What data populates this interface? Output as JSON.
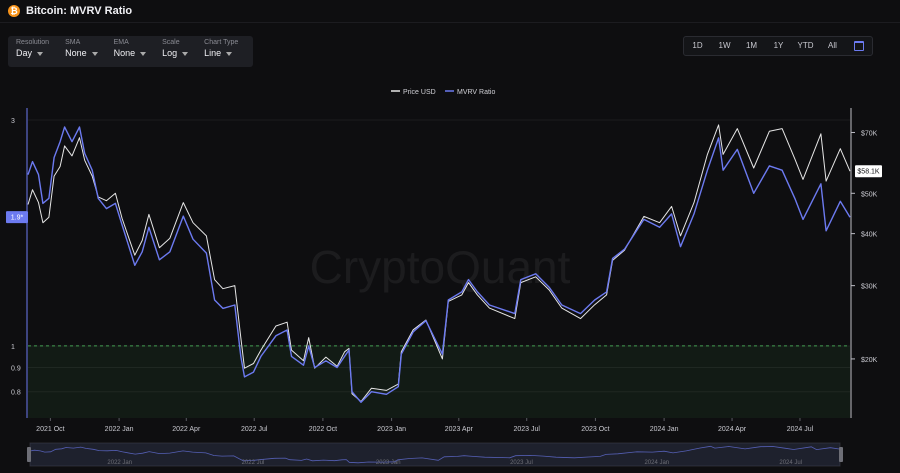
{
  "header": {
    "coin_glyph": "₿",
    "title": "Bitcoin: MVRV Ratio"
  },
  "controls": [
    {
      "label": "Resolution",
      "value": "Day"
    },
    {
      "label": "SMA",
      "value": "None"
    },
    {
      "label": "EMA",
      "value": "None"
    },
    {
      "label": "Scale",
      "value": "Log"
    },
    {
      "label": "Chart Type",
      "value": "Line"
    }
  ],
  "ranges": [
    "1D",
    "1W",
    "1M",
    "1Y",
    "YTD",
    "All"
  ],
  "calendar_icon": "calendar-icon",
  "watermark": "CryptoQuant",
  "colors": {
    "price": "#e6e6e6",
    "mvrv": "#6c7af0",
    "band_line": "#3b9a4a",
    "background": "#0e0e10"
  },
  "chart_data": {
    "type": "line",
    "title": "Bitcoin: MVRV Ratio",
    "legend": [
      {
        "name": "Price USD",
        "color": "#e6e6e6"
      },
      {
        "name": "MVRV Ratio",
        "color": "#6c7af0"
      }
    ],
    "legend_position": "top-center",
    "scale": "log",
    "x_axis": {
      "ticks": [
        "2021 Oct",
        "2022 Jan",
        "2022 Apr",
        "2022 Jul",
        "2022 Oct",
        "2023 Jan",
        "2023 Apr",
        "2023 Jul",
        "2023 Oct",
        "2024 Jan",
        "2024 Apr",
        "2024 Jul"
      ],
      "range": [
        "2021-09-01",
        "2024-09-06"
      ]
    },
    "y_left": {
      "label": "MVRV Ratio",
      "ticks": [
        "3",
        "1",
        "0.9",
        "0.8"
      ],
      "range": [
        0.75,
        3.0
      ],
      "current_value": "1.9*"
    },
    "y_right": {
      "label": "Price USD",
      "ticks": [
        "$70K",
        "$50K",
        "$40K",
        "$30K",
        "$20K"
      ],
      "range": [
        15500,
        75000
      ],
      "current_value": "$58.1K"
    },
    "reference_band": {
      "below": 1.0,
      "style": "dashed green line with shaded zone"
    },
    "series": [
      {
        "name": "Price USD",
        "points": [
          [
            "2021-09-01",
            47000
          ],
          [
            "2021-09-07",
            51000
          ],
          [
            "2021-09-15",
            47500
          ],
          [
            "2021-09-21",
            42500
          ],
          [
            "2021-09-29",
            43800
          ],
          [
            "2021-10-06",
            55000
          ],
          [
            "2021-10-14",
            58000
          ],
          [
            "2021-10-20",
            65000
          ],
          [
            "2021-10-30",
            61500
          ],
          [
            "2021-11-09",
            68000
          ],
          [
            "2021-11-16",
            60000
          ],
          [
            "2021-11-26",
            55000
          ],
          [
            "2021-12-04",
            49000
          ],
          [
            "2021-12-15",
            48000
          ],
          [
            "2021-12-27",
            50000
          ],
          [
            "2022-01-05",
            43500
          ],
          [
            "2022-01-22",
            35500
          ],
          [
            "2022-02-01",
            38500
          ],
          [
            "2022-02-10",
            44500
          ],
          [
            "2022-02-24",
            37000
          ],
          [
            "2022-03-10",
            39000
          ],
          [
            "2022-03-28",
            47500
          ],
          [
            "2022-04-10",
            42500
          ],
          [
            "2022-04-28",
            39500
          ],
          [
            "2022-05-09",
            31000
          ],
          [
            "2022-05-20",
            29500
          ],
          [
            "2022-06-05",
            30000
          ],
          [
            "2022-06-13",
            22500
          ],
          [
            "2022-06-18",
            19000
          ],
          [
            "2022-06-30",
            19500
          ],
          [
            "2022-07-10",
            21000
          ],
          [
            "2022-07-30",
            24000
          ],
          [
            "2022-08-14",
            24500
          ],
          [
            "2022-08-20",
            21000
          ],
          [
            "2022-09-05",
            19800
          ],
          [
            "2022-09-12",
            22500
          ],
          [
            "2022-09-20",
            19000
          ],
          [
            "2022-10-05",
            20200
          ],
          [
            "2022-10-20",
            19200
          ],
          [
            "2022-10-30",
            20800
          ],
          [
            "2022-11-05",
            21200
          ],
          [
            "2022-11-09",
            16500
          ],
          [
            "2022-11-21",
            15800
          ],
          [
            "2022-12-05",
            17000
          ],
          [
            "2022-12-25",
            16800
          ],
          [
            "2023-01-10",
            17400
          ],
          [
            "2023-01-14",
            20800
          ],
          [
            "2023-01-30",
            23500
          ],
          [
            "2023-02-16",
            24800
          ],
          [
            "2023-03-10",
            20000
          ],
          [
            "2023-03-18",
            27500
          ],
          [
            "2023-04-05",
            28500
          ],
          [
            "2023-04-14",
            30500
          ],
          [
            "2023-04-26",
            28500
          ],
          [
            "2023-05-12",
            26500
          ],
          [
            "2023-06-15",
            25000
          ],
          [
            "2023-06-23",
            30500
          ],
          [
            "2023-07-13",
            31500
          ],
          [
            "2023-07-31",
            29300
          ],
          [
            "2023-08-17",
            26500
          ],
          [
            "2023-09-11",
            25000
          ],
          [
            "2023-09-30",
            27000
          ],
          [
            "2023-10-16",
            28500
          ],
          [
            "2023-10-24",
            34500
          ],
          [
            "2023-11-09",
            36500
          ],
          [
            "2023-12-05",
            44000
          ],
          [
            "2023-12-26",
            42500
          ],
          [
            "2024-01-11",
            46500
          ],
          [
            "2024-01-23",
            39500
          ],
          [
            "2024-02-10",
            47500
          ],
          [
            "2024-02-28",
            62000
          ],
          [
            "2024-03-14",
            73000
          ],
          [
            "2024-03-20",
            62000
          ],
          [
            "2024-04-08",
            71500
          ],
          [
            "2024-04-30",
            57500
          ],
          [
            "2024-05-21",
            70500
          ],
          [
            "2024-06-07",
            71500
          ],
          [
            "2024-06-24",
            60500
          ],
          [
            "2024-07-05",
            54000
          ],
          [
            "2024-07-29",
            69500
          ],
          [
            "2024-08-05",
            53500
          ],
          [
            "2024-08-24",
            64000
          ],
          [
            "2024-09-06",
            56500
          ]
        ]
      },
      {
        "name": "MVRV Ratio",
        "points": [
          [
            "2021-09-01",
            2.3
          ],
          [
            "2021-09-07",
            2.45
          ],
          [
            "2021-09-15",
            2.3
          ],
          [
            "2021-09-21",
            2.0
          ],
          [
            "2021-09-29",
            2.05
          ],
          [
            "2021-10-06",
            2.5
          ],
          [
            "2021-10-14",
            2.7
          ],
          [
            "2021-10-20",
            2.9
          ],
          [
            "2021-10-30",
            2.7
          ],
          [
            "2021-11-09",
            2.9
          ],
          [
            "2021-11-16",
            2.55
          ],
          [
            "2021-11-26",
            2.35
          ],
          [
            "2021-12-04",
            2.05
          ],
          [
            "2021-12-15",
            1.95
          ],
          [
            "2021-12-27",
            2.0
          ],
          [
            "2022-01-05",
            1.8
          ],
          [
            "2022-01-22",
            1.48
          ],
          [
            "2022-02-01",
            1.58
          ],
          [
            "2022-02-10",
            1.78
          ],
          [
            "2022-02-24",
            1.52
          ],
          [
            "2022-03-10",
            1.58
          ],
          [
            "2022-03-28",
            1.88
          ],
          [
            "2022-04-10",
            1.68
          ],
          [
            "2022-04-28",
            1.57
          ],
          [
            "2022-05-09",
            1.25
          ],
          [
            "2022-05-20",
            1.2
          ],
          [
            "2022-06-05",
            1.22
          ],
          [
            "2022-06-13",
            0.95
          ],
          [
            "2022-06-18",
            0.86
          ],
          [
            "2022-06-30",
            0.88
          ],
          [
            "2022-07-10",
            0.95
          ],
          [
            "2022-07-30",
            1.05
          ],
          [
            "2022-08-14",
            1.08
          ],
          [
            "2022-08-20",
            0.95
          ],
          [
            "2022-09-05",
            0.91
          ],
          [
            "2022-09-12",
            1.0
          ],
          [
            "2022-09-20",
            0.9
          ],
          [
            "2022-10-05",
            0.93
          ],
          [
            "2022-10-20",
            0.9
          ],
          [
            "2022-10-30",
            0.95
          ],
          [
            "2022-11-05",
            0.98
          ],
          [
            "2022-11-09",
            0.8
          ],
          [
            "2022-11-21",
            0.76
          ],
          [
            "2022-12-05",
            0.8
          ],
          [
            "2022-12-25",
            0.79
          ],
          [
            "2023-01-10",
            0.82
          ],
          [
            "2023-01-14",
            0.96
          ],
          [
            "2023-01-30",
            1.07
          ],
          [
            "2023-02-16",
            1.13
          ],
          [
            "2023-03-10",
            0.96
          ],
          [
            "2023-03-18",
            1.25
          ],
          [
            "2023-04-05",
            1.3
          ],
          [
            "2023-04-14",
            1.38
          ],
          [
            "2023-04-26",
            1.3
          ],
          [
            "2023-05-12",
            1.22
          ],
          [
            "2023-06-15",
            1.17
          ],
          [
            "2023-06-23",
            1.38
          ],
          [
            "2023-07-13",
            1.42
          ],
          [
            "2023-07-31",
            1.33
          ],
          [
            "2023-08-17",
            1.22
          ],
          [
            "2023-09-11",
            1.17
          ],
          [
            "2023-09-30",
            1.25
          ],
          [
            "2023-10-16",
            1.3
          ],
          [
            "2023-10-24",
            1.53
          ],
          [
            "2023-11-09",
            1.6
          ],
          [
            "2023-12-05",
            1.85
          ],
          [
            "2023-12-26",
            1.78
          ],
          [
            "2024-01-11",
            1.9
          ],
          [
            "2024-01-23",
            1.62
          ],
          [
            "2024-02-10",
            1.9
          ],
          [
            "2024-02-28",
            2.35
          ],
          [
            "2024-03-14",
            2.75
          ],
          [
            "2024-03-20",
            2.35
          ],
          [
            "2024-04-08",
            2.6
          ],
          [
            "2024-04-30",
            2.1
          ],
          [
            "2024-05-21",
            2.4
          ],
          [
            "2024-06-07",
            2.35
          ],
          [
            "2024-06-24",
            2.05
          ],
          [
            "2024-07-05",
            1.85
          ],
          [
            "2024-07-29",
            2.2
          ],
          [
            "2024-08-05",
            1.75
          ],
          [
            "2024-08-24",
            2.02
          ],
          [
            "2024-09-06",
            1.87
          ]
        ]
      }
    ],
    "navigator": {
      "ticks": [
        "2022 Jan",
        "2022 Jul",
        "2023 Jan",
        "2023 Jul",
        "2024 Jan",
        "2024 Jul"
      ]
    }
  }
}
